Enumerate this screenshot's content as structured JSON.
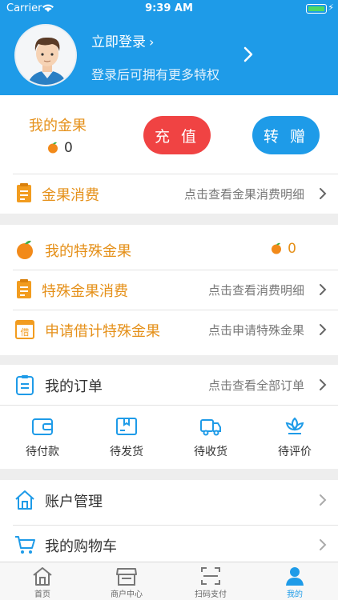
{
  "status_bar": {
    "carrier": "Carrier",
    "time": "9:39 AM"
  },
  "header": {
    "login_label": "立即登录",
    "login_subtitle": "登录后可拥有更多特权"
  },
  "gold": {
    "title": "我的金果",
    "count": "0",
    "recharge_label": "充 值",
    "gift_label": "转 赠"
  },
  "gold_consumption": {
    "label": "金果消费",
    "hint": "点击查看金果消费明细"
  },
  "special": {
    "title": "我的特殊金果",
    "count": "0",
    "consumption_label": "特殊金果消费",
    "consumption_hint": "点击查看消费明细",
    "borrow_label": "申请借计特殊金果",
    "borrow_hint": "点击申请特殊金果",
    "borrow_icon_char": "借"
  },
  "orders": {
    "title": "我的订单",
    "hint": "点击查看全部订单",
    "statuses": [
      {
        "label": "待付款",
        "icon": "wallet-icon"
      },
      {
        "label": "待发货",
        "icon": "package-icon"
      },
      {
        "label": "待收货",
        "icon": "truck-icon"
      },
      {
        "label": "待评价",
        "icon": "lotus-icon"
      }
    ]
  },
  "account": {
    "label": "账户管理"
  },
  "cart": {
    "label": "我的购物车"
  },
  "tabs": [
    {
      "label": "首页",
      "icon": "home-icon",
      "active": false
    },
    {
      "label": "商户中心",
      "icon": "shop-icon",
      "active": false
    },
    {
      "label": "扫码支付",
      "icon": "scan-icon",
      "active": false
    },
    {
      "label": "我的",
      "icon": "person-icon",
      "active": true
    }
  ],
  "colors": {
    "primary": "#1e9be8",
    "recharge": "#f04343",
    "gold": "#e59019",
    "background": "#eeeeee"
  }
}
